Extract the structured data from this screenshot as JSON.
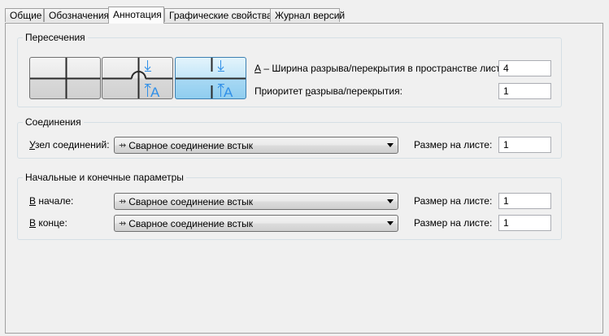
{
  "tabs": [
    {
      "label": "Общие"
    },
    {
      "label": "Обозначения"
    },
    {
      "label": "Аннотация"
    },
    {
      "label": "Графические свойства"
    },
    {
      "label": "Журнал версий"
    }
  ],
  "active_tab": "Аннотация",
  "intersections": {
    "legend": "Пересечения",
    "gap_label_accel": "А",
    "gap_label_rest": " – Ширина разрыва/перекрытия в пространстве листа:",
    "gap_value": "4",
    "priority_label_pre": "Приоритет ",
    "priority_label_accel": "р",
    "priority_label_post": "азрыва/перекрытия:",
    "priority_value": "1",
    "buttons": [
      {
        "name": "plain-crossing"
      },
      {
        "name": "jump-over"
      },
      {
        "name": "gap-break"
      }
    ],
    "icon_letter": "A"
  },
  "connections": {
    "legend": "Соединения",
    "node_label_accel": "У",
    "node_label_rest": "зел соединений:",
    "node_symbol": "⇸",
    "node_value": "Сварное соединение встык",
    "size_label": "Размер на листе:",
    "size_value": "1"
  },
  "endpoints": {
    "legend": "Начальные и конечные параметры",
    "start_label_accel": "В",
    "start_label_rest": " начале:",
    "start_symbol": "⇸",
    "start_value": "Сварное соединение встык",
    "start_size_label": "Размер на листе:",
    "start_size_value": "1",
    "end_label_accel": "В",
    "end_label_rest": " конце:",
    "end_symbol": "⇸",
    "end_value": "Сварное соединение встык",
    "end_size_label": "Размер на листе:",
    "end_size_value": "1"
  },
  "colors": {
    "accent": "#3399ff",
    "selected": "#a9d9f4",
    "group_border": "#d5dfe5"
  }
}
